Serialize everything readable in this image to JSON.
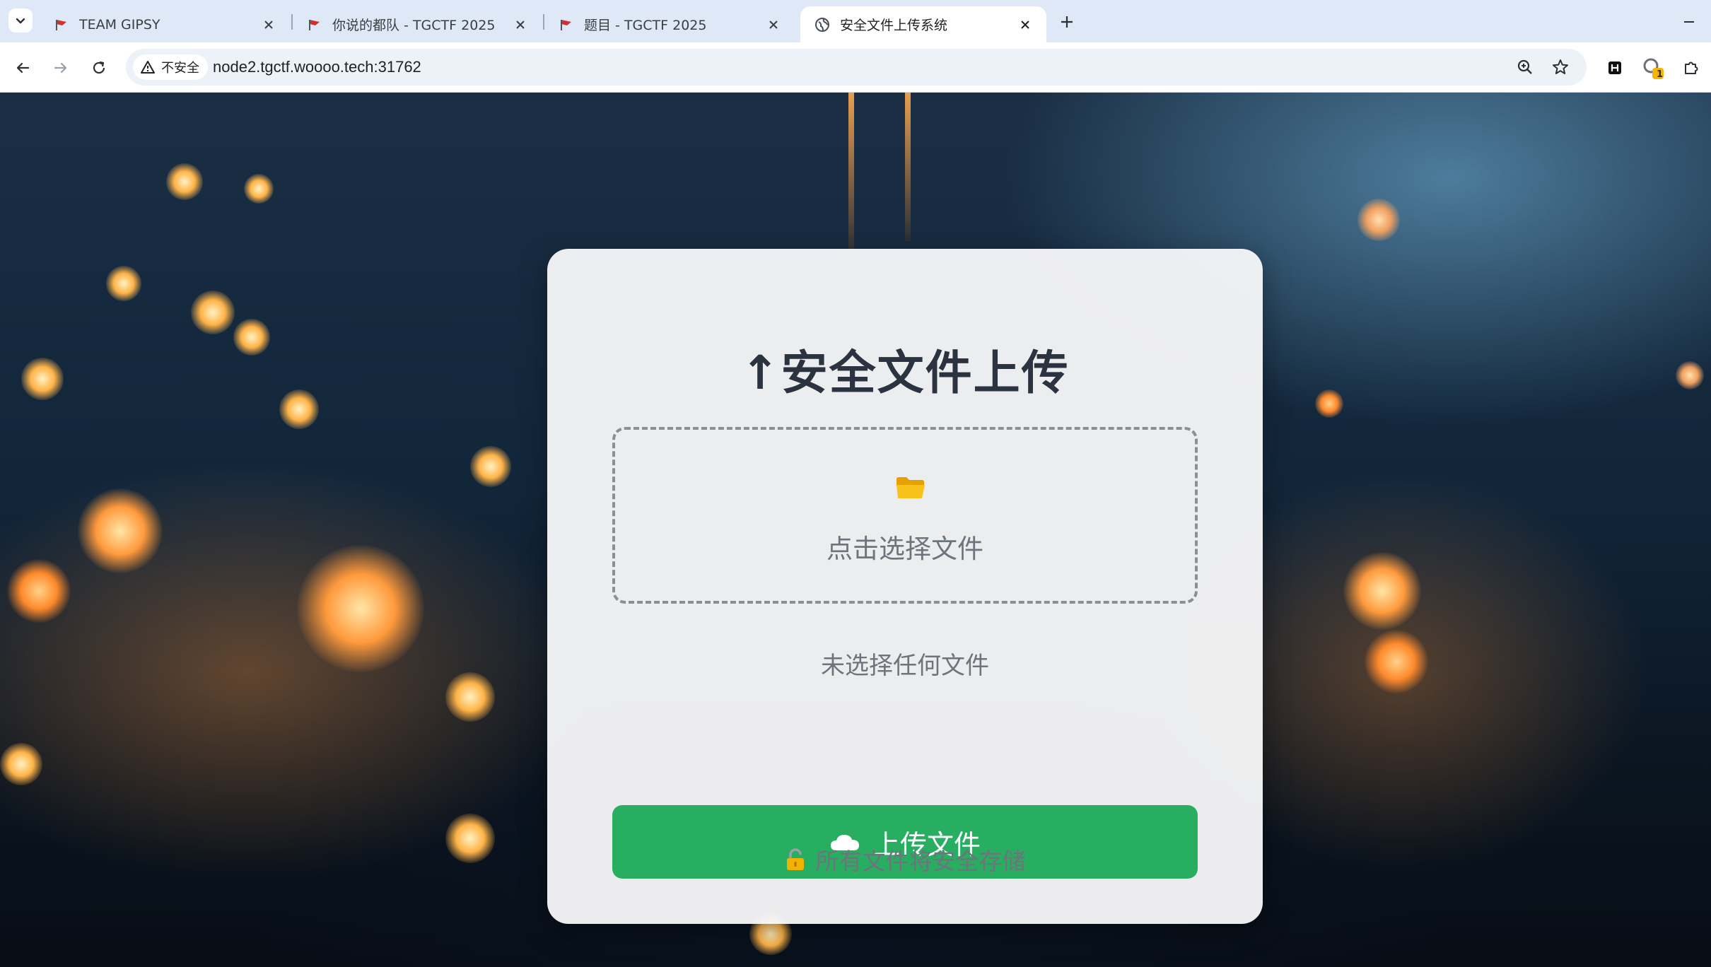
{
  "browser": {
    "tabs": [
      {
        "title": "TEAM GIPSY",
        "active": false,
        "favicon": "red-flag-icon"
      },
      {
        "title": "你说的都队 - TGCTF 2025",
        "active": false,
        "favicon": "red-flag-icon"
      },
      {
        "title": "题目 - TGCTF 2025",
        "active": false,
        "favicon": "red-flag-icon"
      },
      {
        "title": "安全文件上传系统",
        "active": true,
        "favicon": "globe-icon"
      }
    ],
    "security_label": "不安全",
    "url": "node2.tgctf.woooo.tech:31762",
    "extension_badge": "1"
  },
  "page": {
    "title": "↑安全文件上传",
    "dropzone_text": "点击选择文件",
    "file_status": "未选择任何文件",
    "upload_button": "上传文件",
    "footer_note": "所有文件将安全存储"
  },
  "colors": {
    "accent_green": "#27ae60",
    "title_color": "#2c3340",
    "muted_text": "#6e747c"
  }
}
